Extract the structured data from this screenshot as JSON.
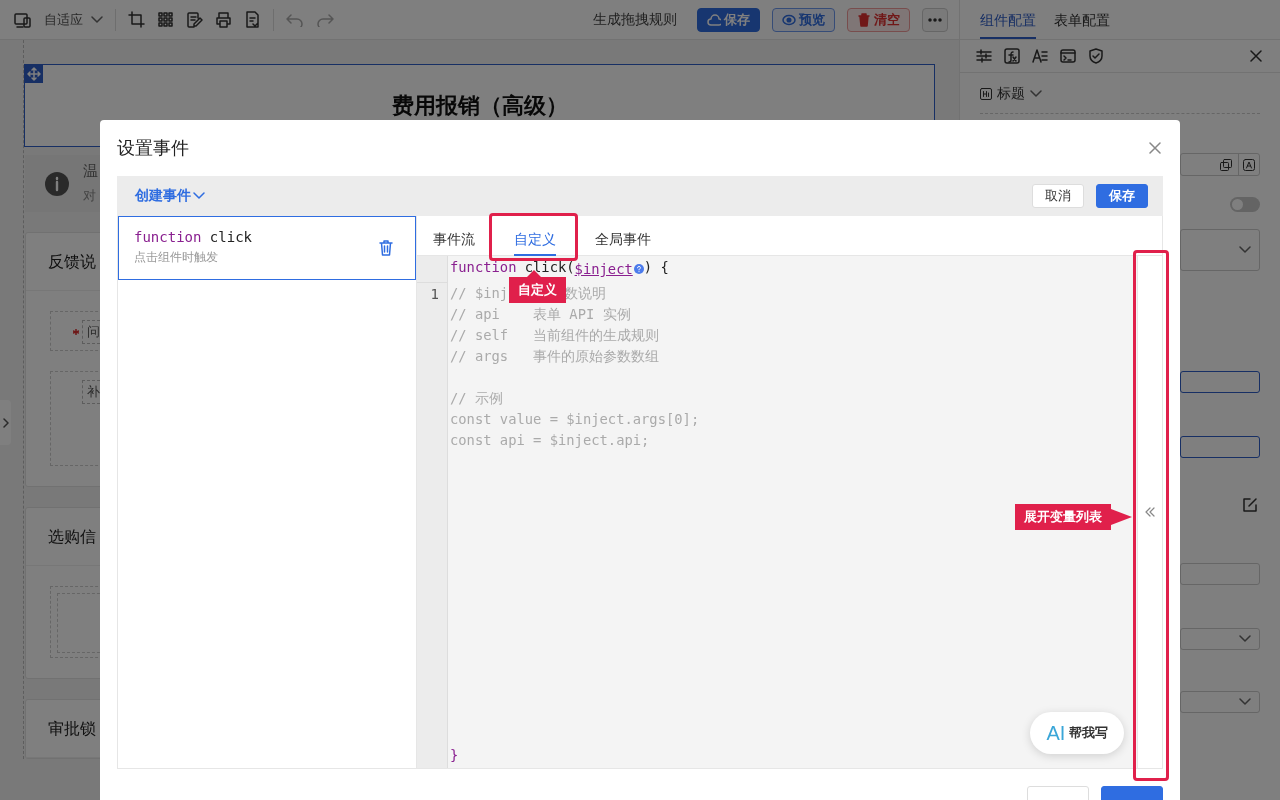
{
  "toolbar": {
    "layout": "自适应",
    "title": "生成拖拽规则",
    "buttons": [
      {
        "label": "保存",
        "kind": "primary"
      },
      {
        "label": "预览",
        "kind": "outline"
      },
      {
        "label": "清空",
        "kind": "danger"
      }
    ]
  },
  "canvas": {
    "form_title": "费用报销（高级）",
    "tip": {
      "title": "温",
      "text": "对"
    },
    "sections": [
      {
        "title": "反馈说",
        "kind": "fields",
        "fields": [
          {
            "label": "问",
            "required": true
          },
          {
            "label": "补",
            "required": false
          }
        ]
      },
      {
        "title": "选购信",
        "kind": "group"
      },
      {
        "title": "审批锁",
        "kind": "plain"
      }
    ]
  },
  "right_panel": {
    "tabs": [
      {
        "label": "组件配置",
        "selected": true
      },
      {
        "label": "表单配置",
        "selected": false
      }
    ],
    "component": "标题",
    "switch_on": false
  },
  "modal": {
    "title": "设置事件",
    "create_event": "创建事件",
    "actions": [
      {
        "label": "取消",
        "kind": "default"
      },
      {
        "label": "保存",
        "kind": "primary"
      }
    ],
    "events": [
      {
        "keyword": "function",
        "name": "click",
        "description": "点击组件时触发",
        "selected": true
      }
    ],
    "tabs": [
      {
        "label": "事件流",
        "selected": false
      },
      {
        "label": "自定义",
        "selected": true
      },
      {
        "label": "全局事件",
        "selected": false
      }
    ],
    "editor": {
      "signature": {
        "keyword": "function",
        "name": "click(",
        "param": "$inject",
        "end": ") {"
      },
      "line_numbers": [
        "1"
      ],
      "lines": [
        {
          "kind": "code",
          "parts": [
            "// $inj",
            "数说明"
          ]
        },
        {
          "kind": "code",
          "parts": [
            "// api    表单 API 实例"
          ]
        },
        {
          "kind": "code",
          "parts": [
            "// self   当前组件的生成规则"
          ]
        },
        {
          "kind": "code",
          "parts": [
            "// args   事件的原始参数数组"
          ]
        },
        {
          "kind": "blank"
        },
        {
          "kind": "code",
          "parts": [
            "// 示例"
          ]
        },
        {
          "kind": "code",
          "parts": [
            "const value = $inject.args[0];"
          ]
        },
        {
          "kind": "code",
          "parts": [
            "const api = $inject.api;"
          ]
        }
      ],
      "closing": "}"
    },
    "ai_button": {
      "logo": "AI",
      "label": "帮我写"
    }
  },
  "annotations": [
    {
      "label": "自定义",
      "kind": "tab"
    },
    {
      "label": "展开变量列表",
      "kind": "strip"
    }
  ]
}
